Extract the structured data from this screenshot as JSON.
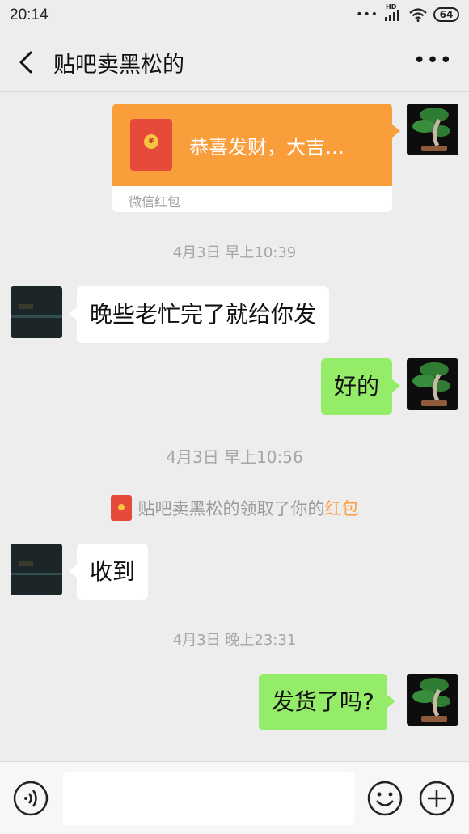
{
  "status_bar": {
    "time": "20:14",
    "network": "HD",
    "battery": "64"
  },
  "nav": {
    "title": "贴吧卖黑松的"
  },
  "messages": {
    "red_packet": {
      "greeting": "恭喜发财，大吉…",
      "label": "微信红包"
    },
    "ts1": "4月3日 早上10:39",
    "m1": "晚些老忙完了就给你发",
    "m2": "好的",
    "ts2": "4月3日 早上10:56",
    "system": {
      "text": "贴吧卖黑松的领取了你的",
      "link": "红包"
    },
    "m3": "收到",
    "ts3": "4月3日 晚上23:31",
    "m4": "发货了吗?"
  },
  "colors": {
    "my_bubble": "#95ec69",
    "red_packet": "#fa9d3b",
    "background": "#ededed"
  },
  "icons": [
    "back-icon",
    "more-icon",
    "voice-icon",
    "emoji-icon",
    "plus-icon"
  ]
}
